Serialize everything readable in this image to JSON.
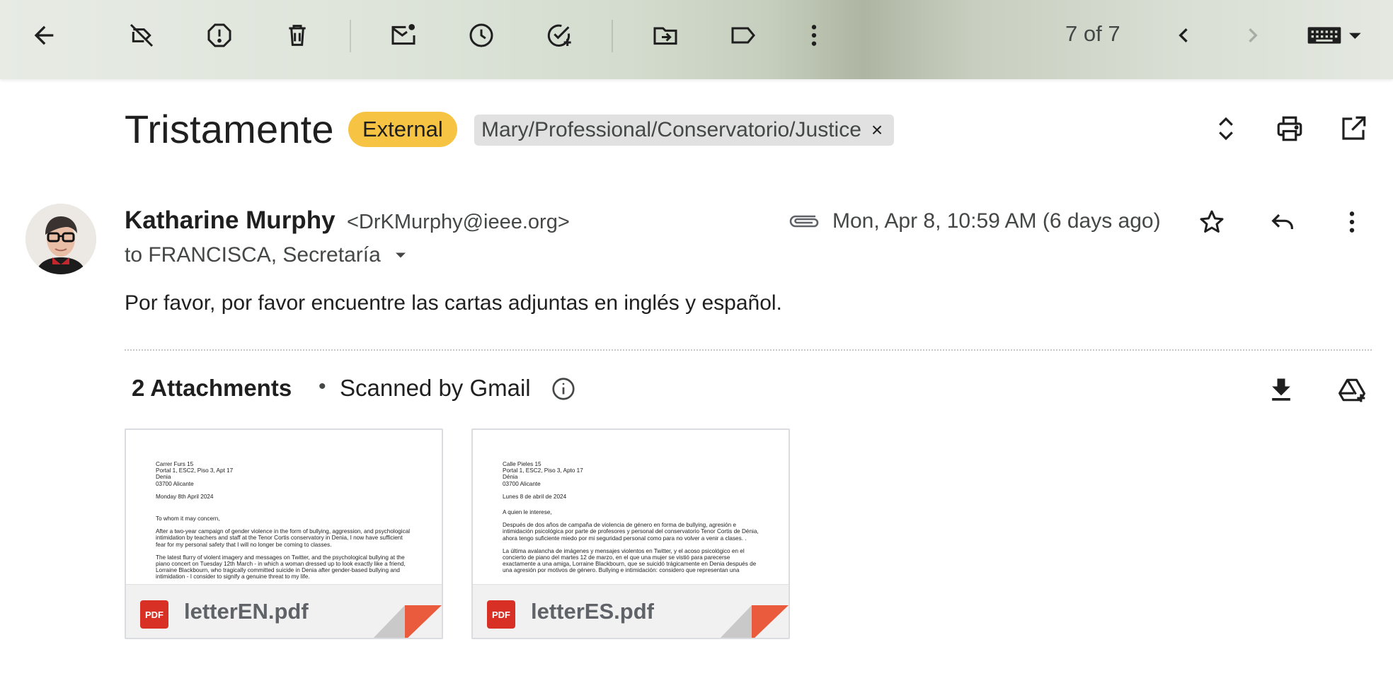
{
  "toolbar": {
    "back": "arrow-back-icon",
    "pager": "7 of 7",
    "icons": [
      "label-off-icon",
      "report-spam-icon",
      "delete-icon",
      "mark-unread-icon",
      "snooze-icon",
      "add-task-icon",
      "move-to-icon",
      "label-icon",
      "more-vert-icon",
      "chevron-left-icon",
      "chevron-right-icon",
      "keyboard-icon"
    ]
  },
  "thread": {
    "subject": "Tristamente",
    "external_badge": "External",
    "label_chip": "Mary/Professional/Conservatorio/Justice",
    "label_remove": "×"
  },
  "message": {
    "sender_name": "Katharine Murphy",
    "sender_email": "<DrKMurphy@ieee.org>",
    "recipients": "to FRANCISCA, Secretaría",
    "date": "Mon, Apr 8, 10:59 AM (6 days ago)",
    "body": "Por favor, por favor encuentre las cartas adjuntas en inglés y español."
  },
  "attachments": {
    "title": "2 Attachments",
    "dot": "•",
    "scanned": "Scanned by Gmail",
    "items": [
      {
        "filename": "letterEN.pdf",
        "type": "PDF",
        "preview": {
          "address": [
            "Carrer Furs 15",
            "Portal 1, ESC2, Piso 3, Apt 17",
            "Denia",
            "03700 Alicante"
          ],
          "date": "Monday 8th April 2024",
          "greeting": "To whom it may concern,",
          "p1": "After a two-year campaign of gender violence in the form of bullying, aggression, and psychological intimidation by teachers and staff at the Tenor Cortis conservatory in Denia, I now have sufficient fear for my personal safety that I will no longer be coming to classes.",
          "p2": "The latest flurry of violent imagery and messages on Twitter, and the psychological bullying at the piano concert on Tuesday 12th March - in which a woman dressed up to look exactly like a friend, Lorraine Blackbourn, who tragically committed suicide in Denia after gender-based bullying and intimidation - I consider to signify a genuine threat to my life."
        }
      },
      {
        "filename": "letterES.pdf",
        "type": "PDF",
        "preview": {
          "address": [
            "Calle Pieles 15",
            "Portal 1, ESC2, Piso 3, Apto 17",
            "Dénia",
            "03700 Alicante"
          ],
          "date": "Lunes 8 de abril de 2024",
          "greeting": "A quien le interese,",
          "p1": "Después de dos años de campaña de violencia de género en forma de bullying, agresión e intimidación psicológica por parte de profesores y personal del conservatorio Tenor Cortis de Dénia, ahora tengo suficiente miedo por mi seguridad personal como para no volver a venir a clases. .",
          "p2": "La última avalancha de imágenes y mensajes violentos en Twitter, y el acoso psicológico en el concierto de piano del martes 12 de marzo, en el que una mujer se vistió para parecerse exactamente a una amiga, Lorraine Blackbourn, que se suicidó trágicamente en Denia después de una agresión por motivos de género. Bullying e intimidación: considero que representan una"
        }
      }
    ]
  },
  "colors": {
    "external_badge": "#f6c343",
    "pdf_red": "#d93025",
    "fold_red": "#ea5a3c"
  }
}
